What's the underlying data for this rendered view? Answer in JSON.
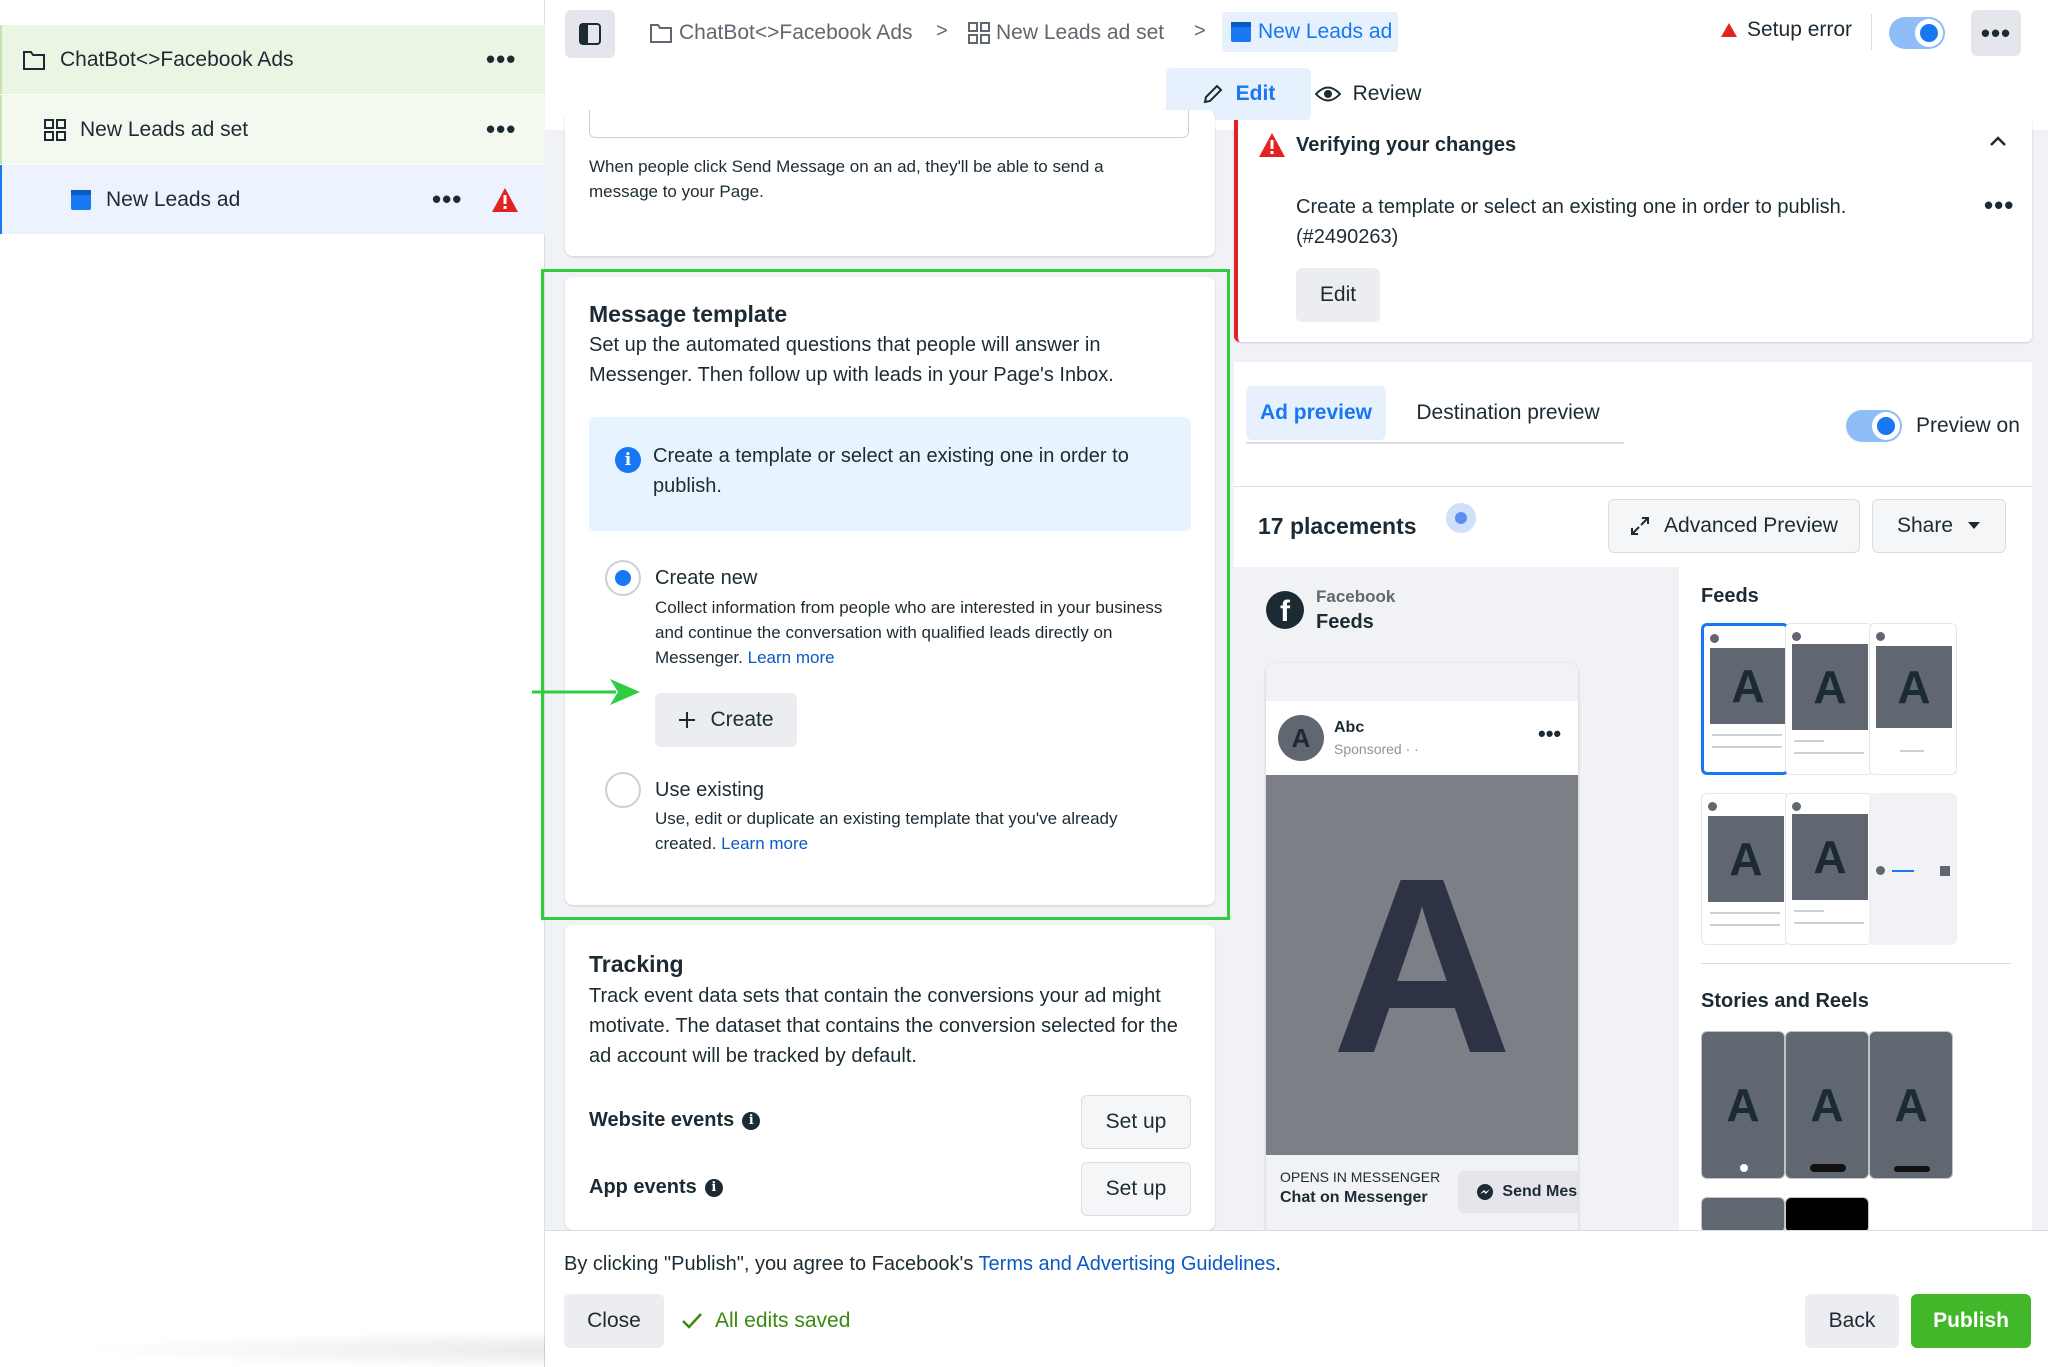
{
  "sidebar": {
    "campaign": {
      "label": "ChatBot<>Facebook Ads",
      "more": "•••"
    },
    "adset": {
      "label": "New Leads ad set",
      "more": "•••"
    },
    "ad": {
      "label": "New Leads ad",
      "more": "•••"
    }
  },
  "topbar": {
    "breadcrumbs": [
      "ChatBot<>Facebook Ads",
      "New Leads ad set",
      "New Leads ad"
    ],
    "separator": ">",
    "setup_error": "Setup error",
    "more": "•••",
    "edit_tab": "Edit",
    "review_tab": "Review"
  },
  "center": {
    "send_message_desc": "When people click Send Message on an ad, they'll be able to send a message to your Page.",
    "template": {
      "title": "Message template",
      "desc": "Set up the automated questions that people will answer in Messenger. Then follow up with leads in your Page's Inbox.",
      "info": "Create a template or select an existing one in order to publish.",
      "create_new": {
        "title": "Create new",
        "desc": "Collect information from people who are interested in your business and continue the conversation with qualified leads directly on Messenger.",
        "link": "Learn more",
        "button": "Create",
        "checked": true
      },
      "use_existing": {
        "title": "Use existing",
        "desc": "Use, edit or duplicate an existing template that you've already created.",
        "link": "Learn more",
        "checked": false
      }
    },
    "tracking": {
      "title": "Tracking",
      "desc": "Track event data sets that contain the conversions your ad might motivate. The dataset that contains the conversion selected for the ad account will be tracked by default.",
      "website_events": "Website events",
      "app_events": "App events",
      "setup_label": "Set up"
    }
  },
  "right": {
    "verify": {
      "title": "Verifying your changes",
      "message": "Create a template or select an existing one in order to publish. (#2490263)",
      "more": "•••",
      "edit": "Edit"
    },
    "tabs": {
      "ad_preview": "Ad preview",
      "destination_preview": "Destination preview"
    },
    "preview_on": "Preview on",
    "placements": "17 placements",
    "advanced_preview": "Advanced Preview",
    "share": "Share",
    "platform": "Facebook",
    "platform_placement": "Feeds",
    "post": {
      "avatar_letter": "A",
      "name": "Abc",
      "sponsored": "Sponsored · ·",
      "more": "•••",
      "image_letter": "A",
      "opens_in": "OPENS IN MESSENGER",
      "chat_on": "Chat on Messenger",
      "send_message": "Send Message"
    },
    "feeds_head": "Feeds",
    "stories_head": "Stories and Reels",
    "thumb_letter": "A"
  },
  "bottom": {
    "terms_prefix": "By clicking \"Publish\", you agree to Facebook's ",
    "terms_link": "Terms and Advertising Guidelines",
    "terms_suffix": ".",
    "close": "Close",
    "saved": "All edits saved",
    "back": "Back",
    "publish": "Publish"
  },
  "colors": {
    "accent": "#1877f2",
    "publish": "#42b72a",
    "error": "#e02424",
    "highlight": "#2ecc40"
  }
}
